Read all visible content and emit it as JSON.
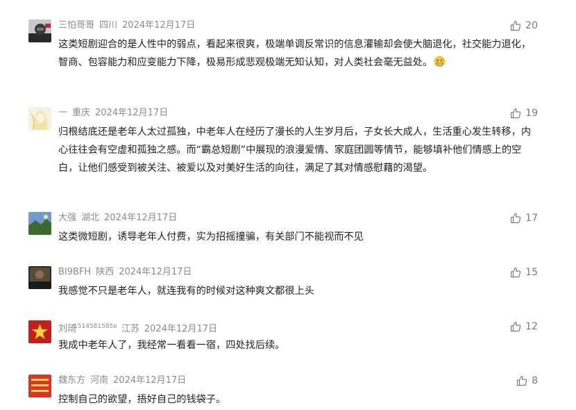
{
  "comments": [
    {
      "author": "三怕哥哥",
      "location": "四川",
      "date": "2024年12月17日",
      "likes": "20",
      "text": "这类短剧迎合的是人性中的弱点，看起来很爽，极端单调反常识的信息灌输却会使大脑退化，社交能力退化，智商、包容能力和应变能力下降，极易形成悲观极端无知认知，对人类社会毫无益处。"
    },
    {
      "author": "一",
      "location": "重庆",
      "date": "2024年12月17日",
      "likes": "19",
      "text": "归根结底还是老年人太过孤独，中老年人在经历了漫长的人生岁月后，子女长大成人，生活重心发生转移，内心往往会有空虚和孤独之感。而“霸总短剧”中展现的浪漫爱情、家庭团圆等情节，能够填补他们情感上的空白，让他们感受到被关注、被爱以及对美好生活的向往，满足了其对情感慰藉的渴望。"
    },
    {
      "author": "大强",
      "location": "湖北",
      "date": "2024年12月17日",
      "likes": "17",
      "text": "这类微短剧，诱导老年人付费，实为招摇撞骗，有关部门不能视而不见"
    },
    {
      "author": "BI9BFH",
      "location": "陕西",
      "date": "2024年12月17日",
      "likes": "15",
      "text": "我感觉不只是老年人，就连我有的时候对这种爽文都很上头"
    },
    {
      "author": "刘琦",
      "author_tag": "1514581585e",
      "location": "江苏",
      "date": "2024年12月17日",
      "likes": "12",
      "text": "我成中老年人了，我经常一看看一宿，四处找后续。"
    },
    {
      "author": "魏东方",
      "location": "河南",
      "date": "2024年12月17日",
      "likes": "8",
      "text": "控制自己的欲望，捂好自己的钱袋子。"
    }
  ],
  "icons": {
    "like": "thumbs-up-icon",
    "emoji": "grimacing-face-emoji"
  },
  "colors": {
    "meta_text": "#8a8a8a",
    "body_text": "#222222",
    "like_icon": "#7a7a7a"
  }
}
